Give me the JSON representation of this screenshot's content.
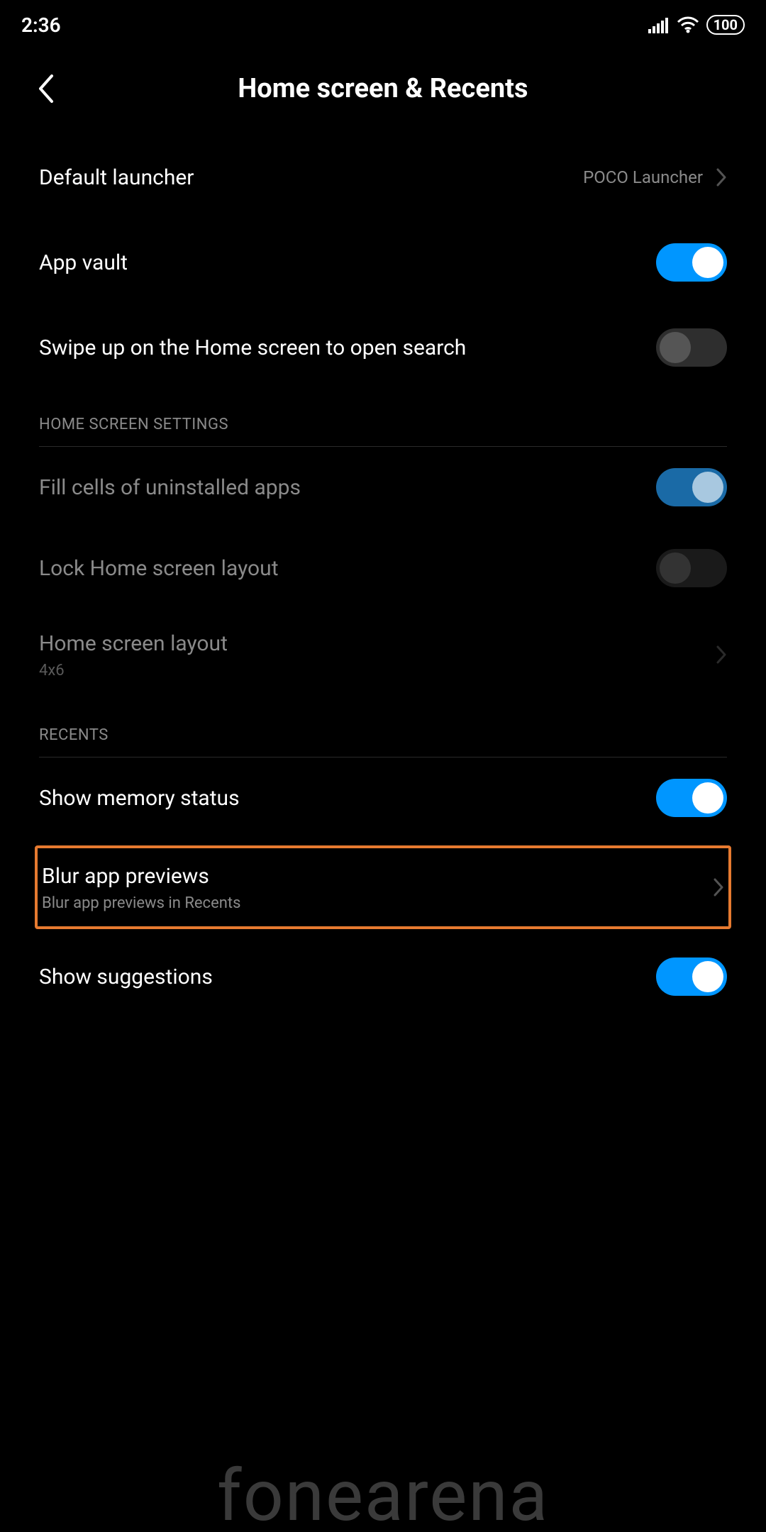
{
  "statusbar": {
    "time": "2:36",
    "battery": "100"
  },
  "header": {
    "title": "Home screen & Recents"
  },
  "rows": {
    "default_launcher": {
      "label": "Default launcher",
      "value": "POCO Launcher"
    },
    "app_vault": {
      "label": "App vault"
    },
    "swipe_search": {
      "label": "Swipe up on the Home screen to open search"
    },
    "fill_cells": {
      "label": "Fill cells of uninstalled apps"
    },
    "lock_layout": {
      "label": "Lock Home screen layout"
    },
    "layout": {
      "label": "Home screen layout",
      "sub": "4x6"
    },
    "show_memory": {
      "label": "Show memory status"
    },
    "blur_previews": {
      "label": "Blur app previews",
      "sub": "Blur app previews in Recents"
    },
    "show_suggestions": {
      "label": "Show suggestions"
    }
  },
  "sections": {
    "home_settings": "HOME SCREEN SETTINGS",
    "recents": "RECENTS"
  },
  "watermark": "fonearena"
}
